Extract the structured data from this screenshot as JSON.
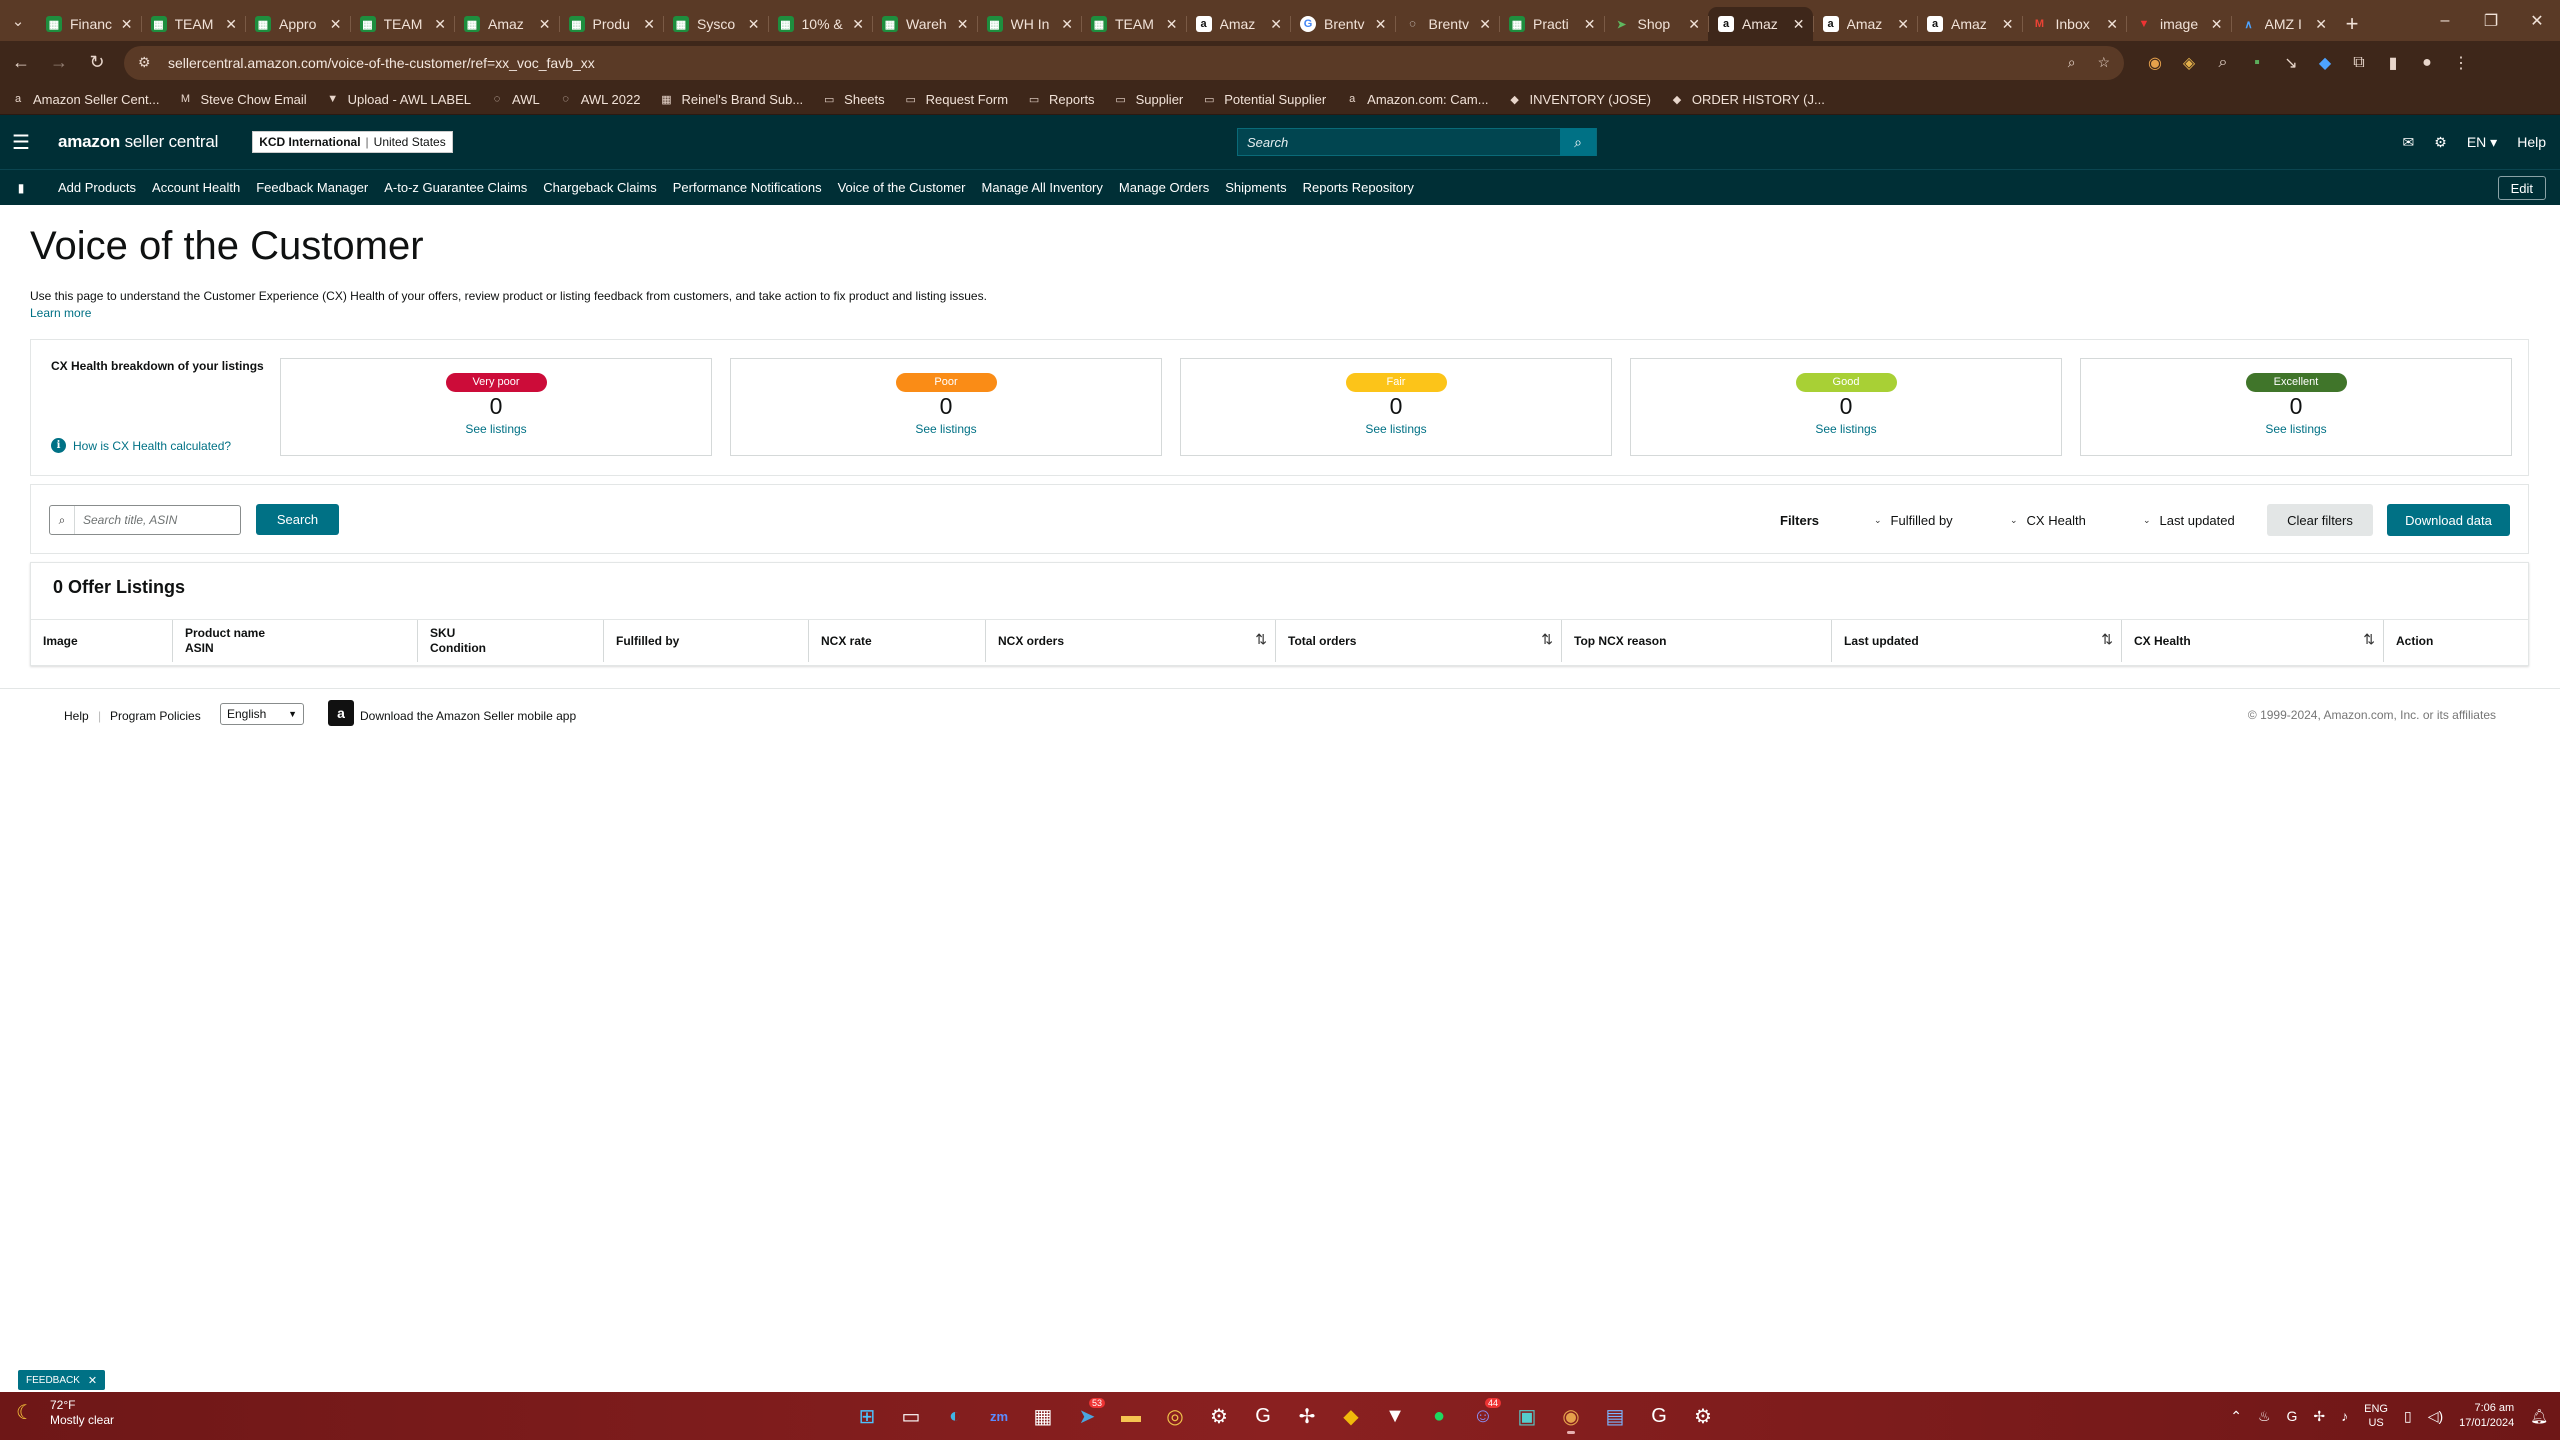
{
  "browser": {
    "tabs": [
      {
        "label": "Financ",
        "icon": "sheets"
      },
      {
        "label": "TEAM",
        "icon": "sheets"
      },
      {
        "label": "Appro",
        "icon": "sheets"
      },
      {
        "label": "TEAM",
        "icon": "sheets"
      },
      {
        "label": "Amaz",
        "icon": "sheets"
      },
      {
        "label": "Produ",
        "icon": "sheets"
      },
      {
        "label": "Sysco",
        "icon": "sheets"
      },
      {
        "label": "10% &",
        "icon": "sheets"
      },
      {
        "label": "Wareh",
        "icon": "sheets"
      },
      {
        "label": "WH In",
        "icon": "sheets"
      },
      {
        "label": "TEAM",
        "icon": "sheets"
      },
      {
        "label": "Amaz",
        "icon": "amazon"
      },
      {
        "label": "Brentv",
        "icon": "google"
      },
      {
        "label": "Brentv",
        "icon": "globe"
      },
      {
        "label": "Practi",
        "icon": "sheets"
      },
      {
        "label": "Shop",
        "icon": "shop"
      },
      {
        "label": "Amaz",
        "icon": "amazon",
        "active": true
      },
      {
        "label": "Amaz",
        "icon": "amazon"
      },
      {
        "label": "Amaz",
        "icon": "amazon"
      },
      {
        "label": "Inbox",
        "icon": "gmail"
      },
      {
        "label": "image",
        "icon": "image"
      },
      {
        "label": "AMZ I",
        "icon": "amz"
      }
    ],
    "url": "sellercentral.amazon.com/voice-of-the-customer/ref=xx_voc_favb_xx",
    "bookmarks": [
      {
        "label": "Amazon Seller Cent...",
        "icon": "amazon-icon"
      },
      {
        "label": "Steve Chow Email",
        "icon": "gmail-icon"
      },
      {
        "label": "Upload - AWL LABEL",
        "icon": "upload-icon"
      },
      {
        "label": "AWL",
        "icon": "globe-icon"
      },
      {
        "label": "AWL 2022",
        "icon": "globe-icon"
      },
      {
        "label": "Reinel's Brand Sub...",
        "icon": "brand-icon"
      },
      {
        "label": "Sheets",
        "icon": "folder-icon"
      },
      {
        "label": "Request Form",
        "icon": "folder-icon"
      },
      {
        "label": "Reports",
        "icon": "folder-icon"
      },
      {
        "label": "Supplier",
        "icon": "folder-icon"
      },
      {
        "label": "Potential Supplier",
        "icon": "folder-icon"
      },
      {
        "label": "Amazon.com: Cam...",
        "icon": "amazon-icon"
      },
      {
        "label": "INVENTORY (JOSE)",
        "icon": "app-icon"
      },
      {
        "label": "ORDER HISTORY (J...",
        "icon": "app-icon"
      }
    ]
  },
  "header": {
    "logo_bold": "amazon",
    "logo_rest": " seller central",
    "account_name": "KCD International",
    "account_region": "United States",
    "search_placeholder": "Search",
    "language": "EN",
    "help": "Help"
  },
  "nav": {
    "links": [
      "Add Products",
      "Account Health",
      "Feedback Manager",
      "A-to-z Guarantee Claims",
      "Chargeback Claims",
      "Performance Notifications",
      "Voice of the Customer",
      "Manage All Inventory",
      "Manage Orders",
      "Shipments",
      "Reports Repository"
    ],
    "edit": "Edit"
  },
  "page": {
    "title": "Voice of the Customer",
    "description": "Use this page to understand the Customer Experience (CX) Health of your offers, review product or listing feedback from customers, and take action to fix product and listing issues.",
    "learn_more": "Learn more"
  },
  "cx_health": {
    "label": "CX Health breakdown of your listings",
    "how_link": "How is CX Health calculated?",
    "cards": [
      {
        "badge": "Very poor",
        "count": "0",
        "link": "See listings",
        "color": "#cc0c39"
      },
      {
        "badge": "Poor",
        "count": "0",
        "link": "See listings",
        "color": "#fa8c16"
      },
      {
        "badge": "Fair",
        "count": "0",
        "link": "See listings",
        "color": "#fcc419"
      },
      {
        "badge": "Good",
        "count": "0",
        "link": "See listings",
        "color": "#a8d035"
      },
      {
        "badge": "Excellent",
        "count": "0",
        "link": "See listings",
        "color": "#40752a"
      }
    ]
  },
  "filters": {
    "search_placeholder": "Search title, ASIN",
    "search_button": "Search",
    "label": "Filters",
    "dropdowns": [
      "Fulfilled by",
      "CX Health",
      "Last updated"
    ],
    "clear": "Clear filters",
    "download": "Download data"
  },
  "table": {
    "count_title": "0 Offer Listings",
    "columns": [
      {
        "line1": "Image",
        "line2": ""
      },
      {
        "line1": "Product name",
        "line2": "ASIN"
      },
      {
        "line1": "SKU",
        "line2": "Condition"
      },
      {
        "line1": "Fulfilled by",
        "line2": ""
      },
      {
        "line1": "NCX rate",
        "line2": ""
      },
      {
        "line1": "NCX orders",
        "line2": "",
        "sortable": true
      },
      {
        "line1": "Total orders",
        "line2": "",
        "sortable": true
      },
      {
        "line1": "Top NCX reason",
        "line2": ""
      },
      {
        "line1": "Last updated",
        "line2": "",
        "sortable": true
      },
      {
        "line1": "CX Health",
        "line2": "",
        "sortable": true
      },
      {
        "line1": "Action",
        "line2": ""
      }
    ]
  },
  "footer": {
    "help": "Help",
    "policies": "Program Policies",
    "language": "English",
    "mobile_app": "Download the Amazon Seller mobile app",
    "copyright": "© 1999-2024, Amazon.com, Inc. or its affiliates"
  },
  "feedback": "FEEDBACK",
  "taskbar": {
    "temperature": "72°F",
    "weather": "Mostly clear",
    "lang_line1": "ENG",
    "lang_line2": "US",
    "time": "7:06 am",
    "date": "17/01/2024",
    "telegram_badge": "53",
    "discord_badge": "44"
  }
}
